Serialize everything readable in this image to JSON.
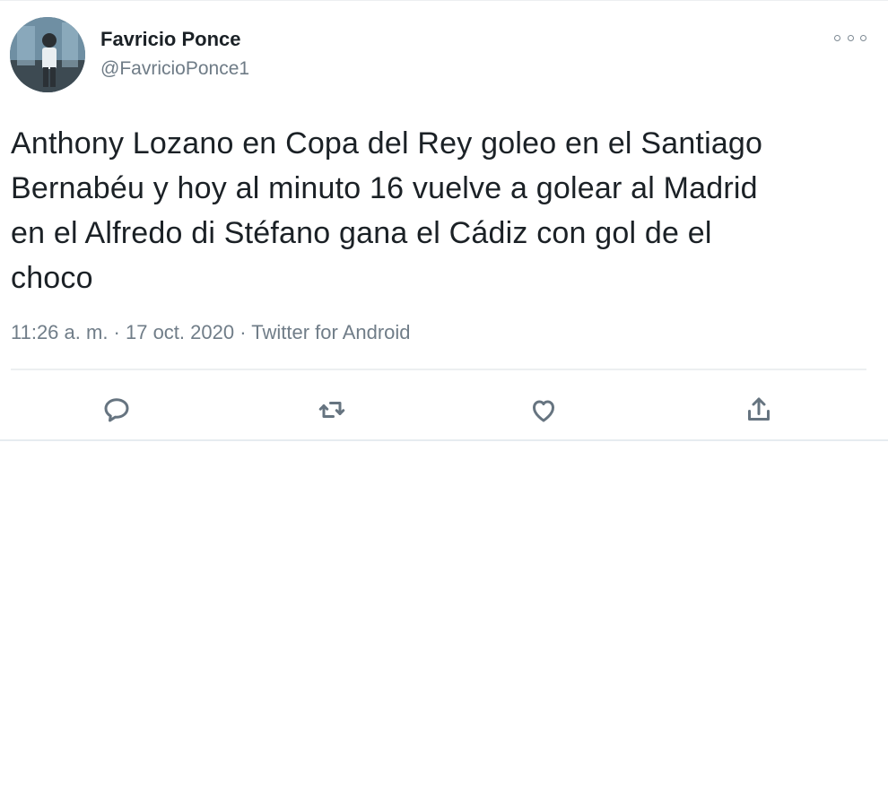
{
  "tweet": {
    "author": {
      "name": "Favricio Ponce",
      "handle": "@FavricioPonce1",
      "avatar_icon": "avatar-photo"
    },
    "text_lines": [
      "Anthony Lozano en Copa del Rey goleo en el Santiago",
      "Bernabéu y hoy al minuto 16 vuelve a golear al Madrid",
      "en el Alfredo di Stéfano gana el Cádiz con gol de el",
      "choco"
    ],
    "meta": "11:26 a. m. · 17 oct. 2020 · Twitter for Android",
    "actions": [
      {
        "icon": "reply-icon"
      },
      {
        "icon": "retweet-icon"
      },
      {
        "icon": "like-icon"
      },
      {
        "icon": "share-icon"
      }
    ],
    "more_icon": "more-options-icon"
  },
  "colors": {
    "text": "#1b2126",
    "secondary": "#707d88",
    "divider": "#eceff1",
    "icon": "#667480"
  }
}
